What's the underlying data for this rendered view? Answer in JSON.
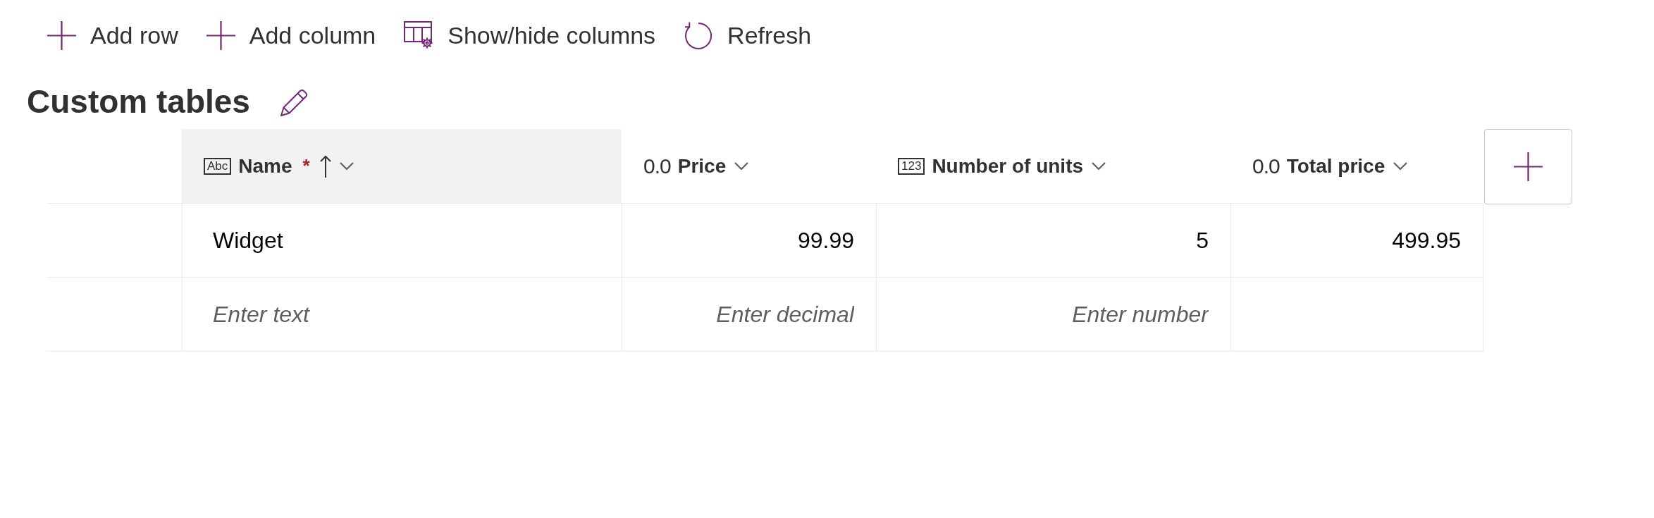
{
  "toolbar": [
    {
      "kind": "add_row",
      "label": "Add row"
    },
    {
      "kind": "add_column",
      "label": "Add column"
    },
    {
      "kind": "show_hide_columns",
      "label": "Show/hide columns"
    },
    {
      "kind": "refresh",
      "label": "Refresh"
    }
  ],
  "title": "Custom tables",
  "table": {
    "columns": [
      {
        "kind": "text",
        "type_label": "Abc",
        "label": "Name",
        "required_mark": "*",
        "sorted": true,
        "selected": true
      },
      {
        "kind": "decimal",
        "type_label": "0.0",
        "label": "Price",
        "sorted": false,
        "selected": false
      },
      {
        "kind": "integer",
        "type_label": "123",
        "label": "Number of units",
        "sorted": false,
        "selected": false
      },
      {
        "kind": "decimal",
        "type_label": "0.0",
        "label": "Total price",
        "sorted": false,
        "selected": false
      }
    ],
    "rows": [
      {
        "cells": [
          {
            "value": "Widget"
          },
          {
            "value": "99.99"
          },
          {
            "value": "5"
          },
          {
            "value": "499.95"
          }
        ]
      },
      {
        "cells": [
          {
            "placeholder": "Enter text"
          },
          {
            "placeholder": "Enter decimal"
          },
          {
            "placeholder": "Enter number"
          }
        ]
      }
    ]
  }
}
